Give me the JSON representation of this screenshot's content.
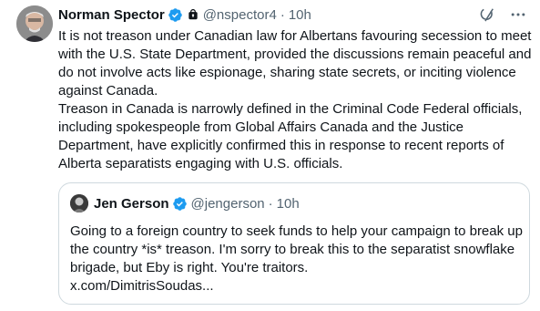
{
  "tweet": {
    "author_name": "Norman Spector",
    "author_handle": "@nspector4",
    "separator": "·",
    "time": "10h",
    "text_paragraph_1": "It is not treason under Canadian law for Albertans favouring secession to meet with the U.S. State Department, provided the discussions remain peaceful and do not involve acts like espionage, sharing state secrets, or inciting violence against Canada.",
    "text_paragraph_2": "Treason in Canada is narrowly defined in the Criminal Code  Federal officials, including spokespeople from Global Affairs Canada and the Justice Department, have explicitly confirmed this in response to recent reports of Alberta separatists engaging with U.S. officials."
  },
  "quote": {
    "author_name": "Jen Gerson",
    "author_handle": "@jengerson",
    "separator": "·",
    "time": "10h",
    "text": "Going to a foreign country to seek funds to help your campaign to break up the country *is* treason. I'm sorry to break this to the separatist snowflake brigade, but Eby is right. You're traitors.",
    "link": "x.com/DimitrisSoudas..."
  },
  "icons": {
    "verified": "verified-badge-icon",
    "lock": "lock-icon",
    "grok": "grok-icon",
    "more": "more-icon"
  },
  "colors": {
    "verified_blue": "#1d9bf0",
    "secondary_text": "#536471",
    "border": "#cfd9de"
  }
}
